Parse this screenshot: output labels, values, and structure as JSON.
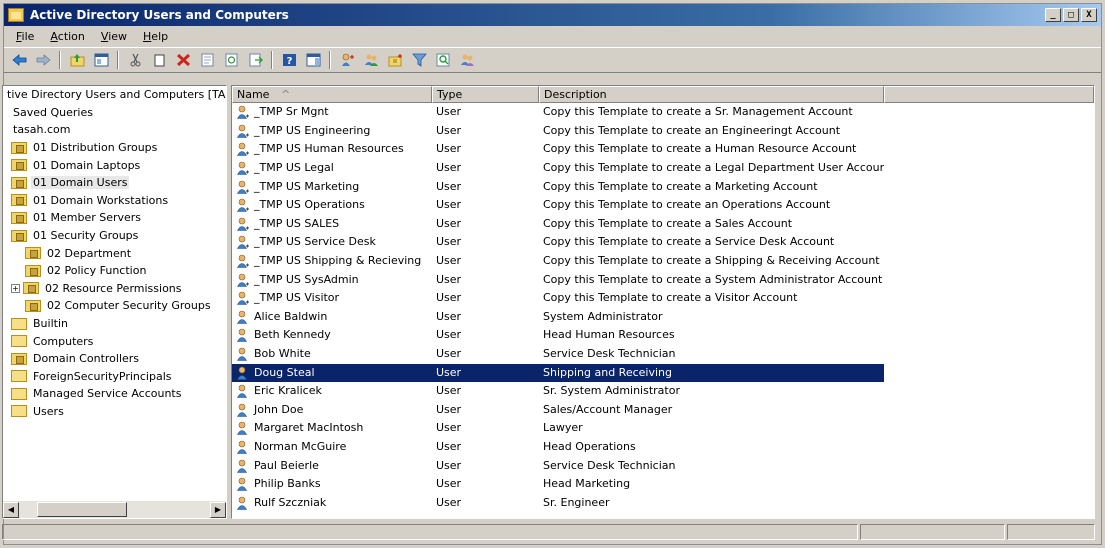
{
  "window": {
    "title": "Active Directory Users and Computers",
    "controls": [
      "_",
      "□",
      "X"
    ]
  },
  "menu": [
    {
      "prefix": "",
      "accel": "F",
      "suffix": "ile"
    },
    {
      "prefix": "",
      "accel": "A",
      "suffix": "ction"
    },
    {
      "prefix": "",
      "accel": "V",
      "suffix": "iew"
    },
    {
      "prefix": "",
      "accel": "H",
      "suffix": "elp"
    }
  ],
  "tree": {
    "items": [
      {
        "label": "tive Directory Users and Computers [TA:",
        "indent": 0,
        "icon": "none"
      },
      {
        "label": "Saved Queries",
        "indent": 1,
        "icon": "none"
      },
      {
        "label": "tasah.com",
        "indent": 1,
        "icon": "none"
      },
      {
        "label": "01 Distribution Groups",
        "indent": 1,
        "icon": "ou"
      },
      {
        "label": "01 Domain Laptops",
        "indent": 1,
        "icon": "ou"
      },
      {
        "label": "01 Domain Users",
        "indent": 1,
        "icon": "ou",
        "selected": true
      },
      {
        "label": "01 Domain Workstations",
        "indent": 1,
        "icon": "ou"
      },
      {
        "label": "01 Member Servers",
        "indent": 1,
        "icon": "ou"
      },
      {
        "label": "01 Security Groups",
        "indent": 1,
        "icon": "ou"
      },
      {
        "label": "02 Department",
        "indent": 2,
        "icon": "ou"
      },
      {
        "label": "02 Policy Function",
        "indent": 2,
        "icon": "ou"
      },
      {
        "label": "02 Resource Permissions",
        "indent": 2,
        "icon": "ou",
        "expander": "+"
      },
      {
        "label": "02 Computer Security Groups",
        "indent": 2,
        "icon": "ou"
      },
      {
        "label": "Builtin",
        "indent": 1,
        "icon": "plain"
      },
      {
        "label": "Computers",
        "indent": 1,
        "icon": "plain"
      },
      {
        "label": "Domain Controllers",
        "indent": 1,
        "icon": "ou"
      },
      {
        "label": "ForeignSecurityPrincipals",
        "indent": 1,
        "icon": "plain"
      },
      {
        "label": "Managed Service Accounts",
        "indent": 1,
        "icon": "plain"
      },
      {
        "label": "Users",
        "indent": 1,
        "icon": "plain"
      }
    ]
  },
  "list": {
    "columns": [
      "Name",
      "Type",
      "Description"
    ],
    "sort_indicator": "^",
    "rows": [
      {
        "name": "_TMP Sr Mgnt",
        "type": "User",
        "desc": "Copy this Template to create a Sr. Management Account",
        "template": true
      },
      {
        "name": "_TMP US Engineering",
        "type": "User",
        "desc": "Copy this Template to create an Engineeringt Account",
        "template": true
      },
      {
        "name": "_TMP US Human Resources",
        "type": "User",
        "desc": "Copy this Template to create a Human Resource Account",
        "template": true
      },
      {
        "name": "_TMP US Legal",
        "type": "User",
        "desc": "Copy this Template to create a Legal Department User Account",
        "template": true
      },
      {
        "name": "_TMP US Marketing",
        "type": "User",
        "desc": "Copy this Template to create a Marketing Account",
        "template": true
      },
      {
        "name": "_TMP US Operations",
        "type": "User",
        "desc": "Copy this Template to create an Operations Account",
        "template": true
      },
      {
        "name": "_TMP US SALES",
        "type": "User",
        "desc": "Copy this Template to create a Sales Account",
        "template": true
      },
      {
        "name": "_TMP US Service Desk",
        "type": "User",
        "desc": "Copy this Template to create a Service Desk Account",
        "template": true
      },
      {
        "name": "_TMP US Shipping & Recieving",
        "type": "User",
        "desc": "Copy this Template to create a Shipping & Receiving Account",
        "template": true
      },
      {
        "name": "_TMP US SysAdmin",
        "type": "User",
        "desc": "Copy this Template to create a System Administrator Account",
        "template": true
      },
      {
        "name": "_TMP US Visitor",
        "type": "User",
        "desc": "Copy this Template to create a Visitor Account",
        "template": true
      },
      {
        "name": "Alice Baldwin",
        "type": "User",
        "desc": "System Administrator"
      },
      {
        "name": "Beth Kennedy",
        "type": "User",
        "desc": "Head Human Resources"
      },
      {
        "name": "Bob White",
        "type": "User",
        "desc": "Service Desk Technician"
      },
      {
        "name": "Doug Steal",
        "type": "User",
        "desc": "Shipping and Receiving",
        "selected": true
      },
      {
        "name": "Eric Kralicek",
        "type": "User",
        "desc": "Sr. System Administrator"
      },
      {
        "name": "John Doe",
        "type": "User",
        "desc": "Sales/Account Manager"
      },
      {
        "name": "Margaret MacIntosh",
        "type": "User",
        "desc": "Lawyer"
      },
      {
        "name": "Norman McGuire",
        "type": "User",
        "desc": "Head Operations"
      },
      {
        "name": "Paul Beierle",
        "type": "User",
        "desc": "Service Desk Technician"
      },
      {
        "name": "Philip Banks",
        "type": "User",
        "desc": "Head Marketing"
      },
      {
        "name": "Rulf Szczniak",
        "type": "User",
        "desc": "Sr. Engineer"
      }
    ]
  },
  "toolbar_icons": [
    "back-arrow-icon",
    "forward-arrow-icon",
    "up-folder-icon",
    "show-console-tree-icon",
    "cut-icon",
    "copy-icon",
    "delete-icon",
    "properties-icon",
    "refresh-icon",
    "export-list-icon",
    "help-icon",
    "show-hide-action-pane-icon",
    "new-user-icon",
    "new-group-icon",
    "new-ou-icon",
    "filter-icon",
    "find-icon",
    "add-to-group-icon"
  ],
  "colors": {
    "selection": "#0a246a",
    "title_start": "#0a246a",
    "title_end": "#a6caf0"
  }
}
